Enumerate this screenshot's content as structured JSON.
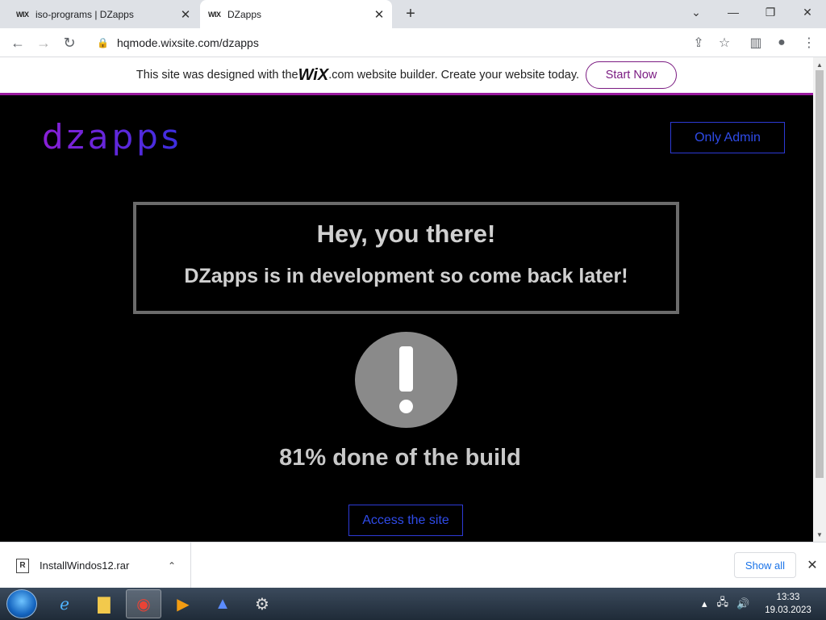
{
  "browser": {
    "tabs": [
      {
        "favicon": "WIX",
        "title": "iso-programs | DZapps"
      },
      {
        "favicon": "WIX",
        "title": "DZapps"
      }
    ],
    "url": "hqmode.wixsite.com/dzapps"
  },
  "wix_banner": {
    "text_before": "This site was designed with the ",
    "logo": "WiX",
    "text_after": ".com website builder. Create your website today.",
    "cta": "Start Now"
  },
  "site": {
    "logo": "dzapps",
    "admin_button": "Only Admin",
    "notice_title": "Hey, you there!",
    "notice_subtitle": "DZapps is in development so come back later!",
    "progress": {
      "percent": 81,
      "text": "81% done of the build"
    },
    "access_button": "Access the site"
  },
  "downloads": {
    "file": "InstallWindos12.rar",
    "show_all": "Show all"
  },
  "taskbar": {
    "time": "13:33",
    "date": "19.03.2023"
  },
  "colors": {
    "accent_purple": "#7b1c82",
    "button_blue": "#2f4be8"
  }
}
